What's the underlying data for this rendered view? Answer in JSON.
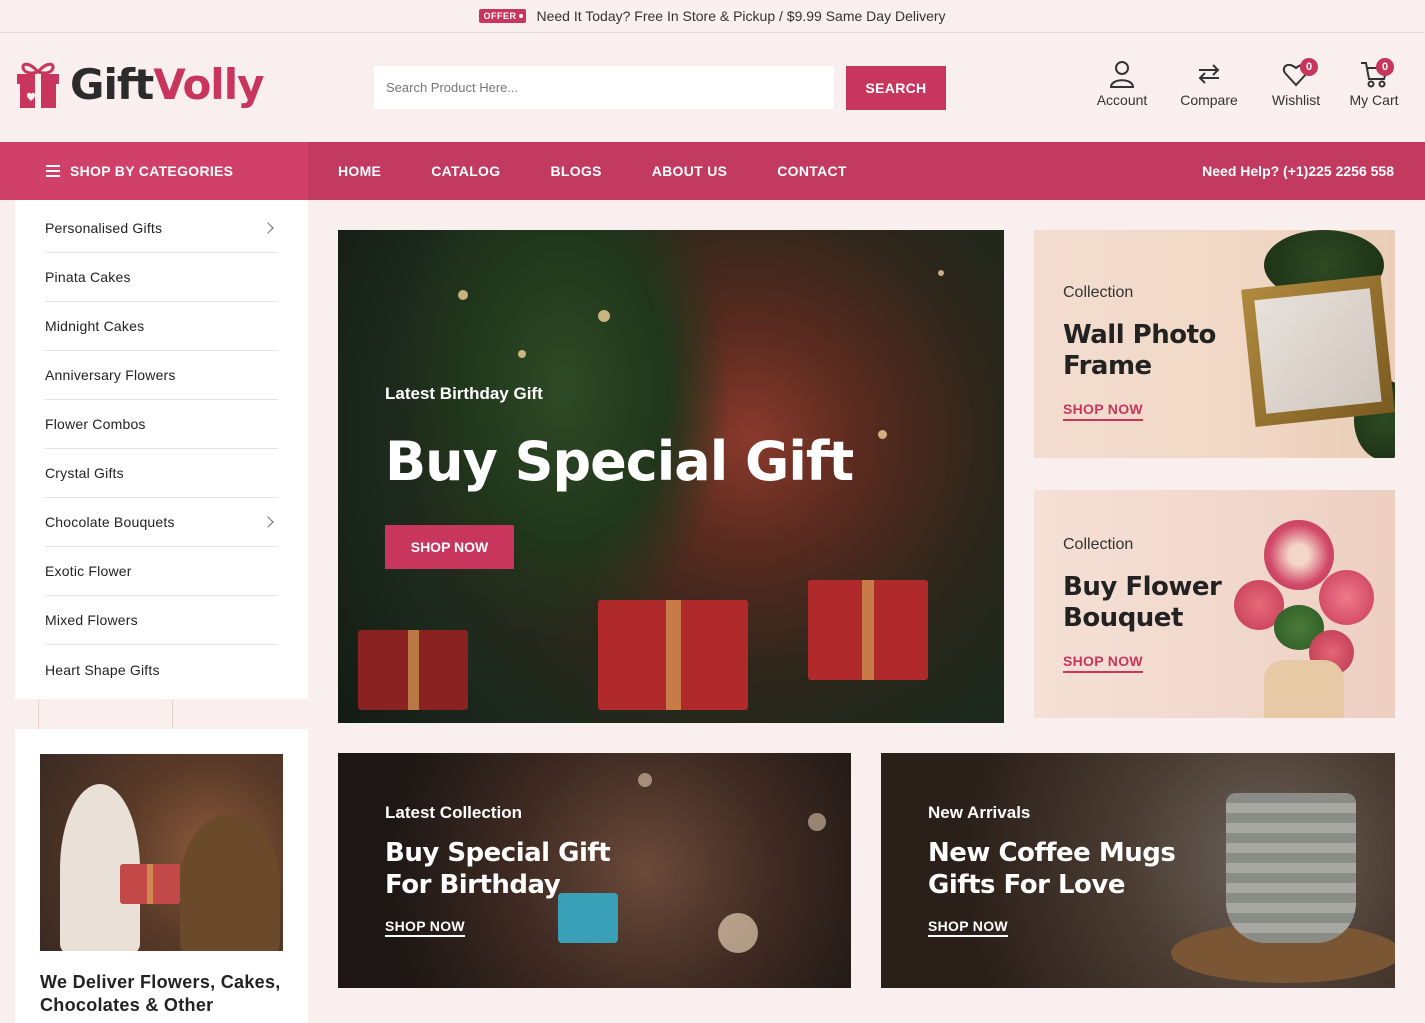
{
  "topbar": {
    "offer_tag": "OFFER",
    "message": "Need It Today? Free In Store & Pickup / $9.99 Same Day Delivery"
  },
  "brand": {
    "name_part1": "Gift",
    "name_part2": "Volly",
    "accent": "#c8365e"
  },
  "search": {
    "placeholder": "Search Product Here...",
    "value": "",
    "button_label": "SEARCH"
  },
  "header_actions": [
    {
      "icon": "user-icon",
      "label": "Account"
    },
    {
      "icon": "compare-icon",
      "label": "Compare"
    },
    {
      "icon": "heart-icon",
      "label": "Wishlist",
      "count": "0"
    },
    {
      "icon": "cart-icon",
      "label": "My Cart",
      "count": "0"
    }
  ],
  "nav": {
    "categories_label": "SHOP BY CATEGORIES",
    "links": [
      "HOME",
      "CATALOG",
      "BLOGS",
      "ABOUT US",
      "CONTACT"
    ],
    "help": "Need Help? (+1)225 2256 558"
  },
  "categories": [
    {
      "label": "Personalised Gifts",
      "has_submenu": true
    },
    {
      "label": "Pinata Cakes",
      "has_submenu": false
    },
    {
      "label": "Midnight Cakes",
      "has_submenu": false
    },
    {
      "label": "Anniversary Flowers",
      "has_submenu": false
    },
    {
      "label": "Flower Combos",
      "has_submenu": false
    },
    {
      "label": "Crystal Gifts",
      "has_submenu": false
    },
    {
      "label": "Chocolate Bouquets",
      "has_submenu": true
    },
    {
      "label": "Exotic Flower",
      "has_submenu": false
    },
    {
      "label": "Mixed Flowers",
      "has_submenu": false
    },
    {
      "label": "Heart Shape Gifts",
      "has_submenu": false
    }
  ],
  "hero": {
    "kicker": "Latest Birthday Gift",
    "title": "Buy Special Gift",
    "button": "SHOP NOW"
  },
  "side_banners": [
    {
      "kicker": "Collection",
      "title_line1": "Wall Photo",
      "title_line2": "Frame",
      "link": "SHOP NOW"
    },
    {
      "kicker": "Collection",
      "title_line1": "Buy Flower",
      "title_line2": "Bouquet",
      "link": "SHOP NOW"
    }
  ],
  "promos": [
    {
      "kicker": "Latest Collection",
      "title_line1": "Buy Special Gift",
      "title_line2": "For Birthday",
      "link": "SHOP NOW"
    },
    {
      "kicker": "New Arrivals",
      "title_line1": "New Coffee Mugs",
      "title_line2": "Gifts For Love",
      "link": "SHOP NOW"
    }
  ],
  "deliver": {
    "line1": "We Deliver Flowers, Cakes,",
    "line2": "Chocolates & Other"
  }
}
